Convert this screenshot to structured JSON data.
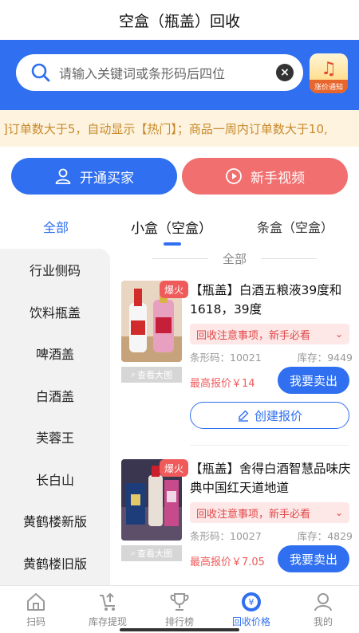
{
  "page_title": "空盒（瓶盖）回收",
  "search": {
    "placeholder": "请输入关键词或条形码后四位"
  },
  "notice_icon_label": "涨价通知",
  "marquee_text": "]订单数大于5，自动显示【热门】；商品一周内订单数大于10,",
  "buttons": {
    "open_buyer": "开通买家",
    "newbie_video": "新手视频"
  },
  "tabs": [
    {
      "label": "全部"
    },
    {
      "label": "小盒（空盒）"
    },
    {
      "label": "条盒（空盒）"
    }
  ],
  "sidebar": {
    "items": [
      {
        "label": "行业侧码"
      },
      {
        "label": "饮料瓶盖"
      },
      {
        "label": "啤酒盖"
      },
      {
        "label": "白酒盖"
      },
      {
        "label": "芙蓉王"
      },
      {
        "label": "长白山"
      },
      {
        "label": "黄鹤楼新版"
      },
      {
        "label": "黄鹤楼旧版"
      }
    ]
  },
  "section_title": "全部",
  "products": [
    {
      "badge": "爆火",
      "view_large": "查看大图",
      "title": "【瓶盖】白酒五粮液39度和1618，39度",
      "caution": "回收注意事项，新手必看",
      "barcode_label": "条形码：",
      "barcode": "10021",
      "stock_label": "库存：",
      "stock": "9449",
      "price": "最高报价￥14",
      "sell": "我要卖出",
      "quote": "创建报价"
    },
    {
      "badge": "爆火",
      "view_large": "查看大图",
      "title": "【瓶盖】舍得白酒智慧品味庆典中国红天道地道",
      "caution": "回收注意事项，新手必看",
      "barcode_label": "条形码：",
      "barcode": "10027",
      "stock_label": "库存：",
      "stock": "4829",
      "price": "最高报价￥7.05",
      "sell": "我要卖出"
    }
  ],
  "tabbar": [
    {
      "label": "扫码",
      "icon": "home-icon"
    },
    {
      "label": "库存提现",
      "icon": "withdraw-icon"
    },
    {
      "label": "排行榜",
      "icon": "trophy-icon"
    },
    {
      "label": "回收价格",
      "icon": "price-icon",
      "active": true
    },
    {
      "label": "我的",
      "icon": "user-icon"
    }
  ],
  "colors": {
    "primary": "#2f6ff0",
    "danger": "#ef5b5b",
    "marquee_text": "#c98a2c"
  }
}
